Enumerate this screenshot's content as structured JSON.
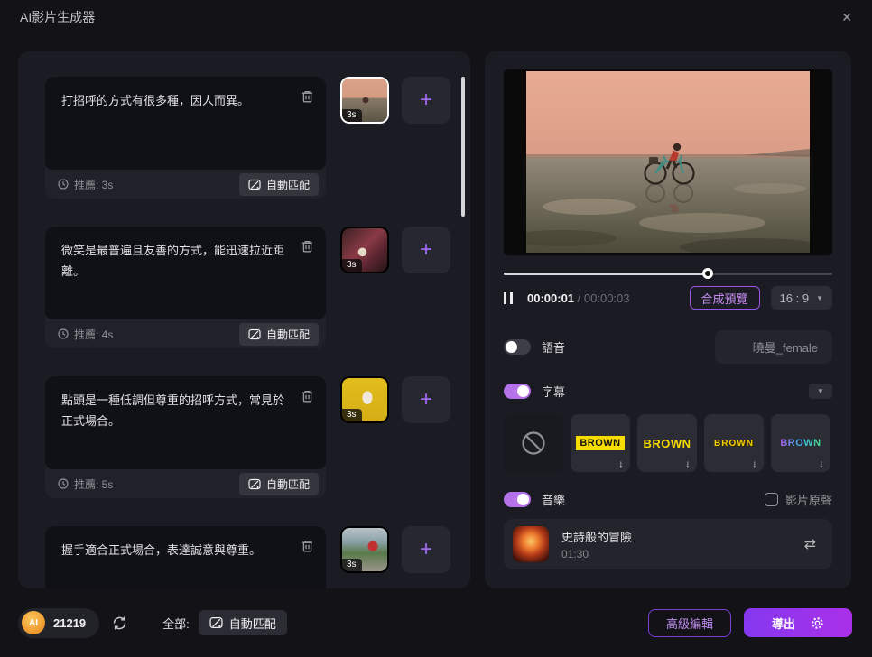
{
  "titlebar": {
    "title": "AI影片生成器",
    "close": "✕"
  },
  "icons": {
    "plus": "+",
    "caret": "▼",
    "download": "↓",
    "swap": "⇄"
  },
  "colors": {
    "accent_purple": "#a36bf5",
    "toggle_on": "#b672e8",
    "subtitle_yellow": "#f7dc00",
    "export_gradient_start": "#8438f0",
    "export_gradient_end": "#aa30e8",
    "ai_coin_orange": "#f0a236"
  },
  "left_panel": {
    "cards": [
      {
        "text": "打招呼的方式有很多種，因人而異。",
        "recommend": "推薦: 3s",
        "match_label": "自動匹配",
        "duration": "3s"
      },
      {
        "text": "微笑是最普遍且友善的方式，能迅速拉近距離。",
        "recommend": "推薦: 4s",
        "match_label": "自動匹配",
        "duration": "3s"
      },
      {
        "text": "點頭是一種低調但尊重的招呼方式，常見於正式場合。",
        "recommend": "推薦: 5s",
        "match_label": "自動匹配",
        "duration": "3s"
      },
      {
        "text": "握手適合正式場合，表達誠意與尊重。",
        "recommend": "",
        "match_label": "",
        "duration": "3s"
      }
    ]
  },
  "preview": {
    "current_time": "00:00:01",
    "separator": " / ",
    "total_time": "00:00:03",
    "synthesize_label": "合成預覽",
    "aspect_ratio": "16 : 9"
  },
  "voice": {
    "label": "語音",
    "name": "曉曼_female"
  },
  "subtitle": {
    "label": "字幕",
    "styles": [
      {
        "type": "none",
        "label": ""
      },
      {
        "type": "badge",
        "label": "BROWN"
      },
      {
        "type": "text-large",
        "label": "BROWN"
      },
      {
        "type": "text-outline",
        "label": "BROWN"
      },
      {
        "type": "gradient",
        "label": "BROWN"
      }
    ]
  },
  "music": {
    "label": "音樂",
    "original_sound_label": "影片原聲",
    "track_title": "史詩般的冒險",
    "track_duration": "01:30"
  },
  "footer": {
    "ai_label": "AI",
    "credits": "21219",
    "all_label": "全部:",
    "match_all_label": "自動匹配",
    "advanced_label": "高級編輯",
    "export_label": "導出"
  }
}
